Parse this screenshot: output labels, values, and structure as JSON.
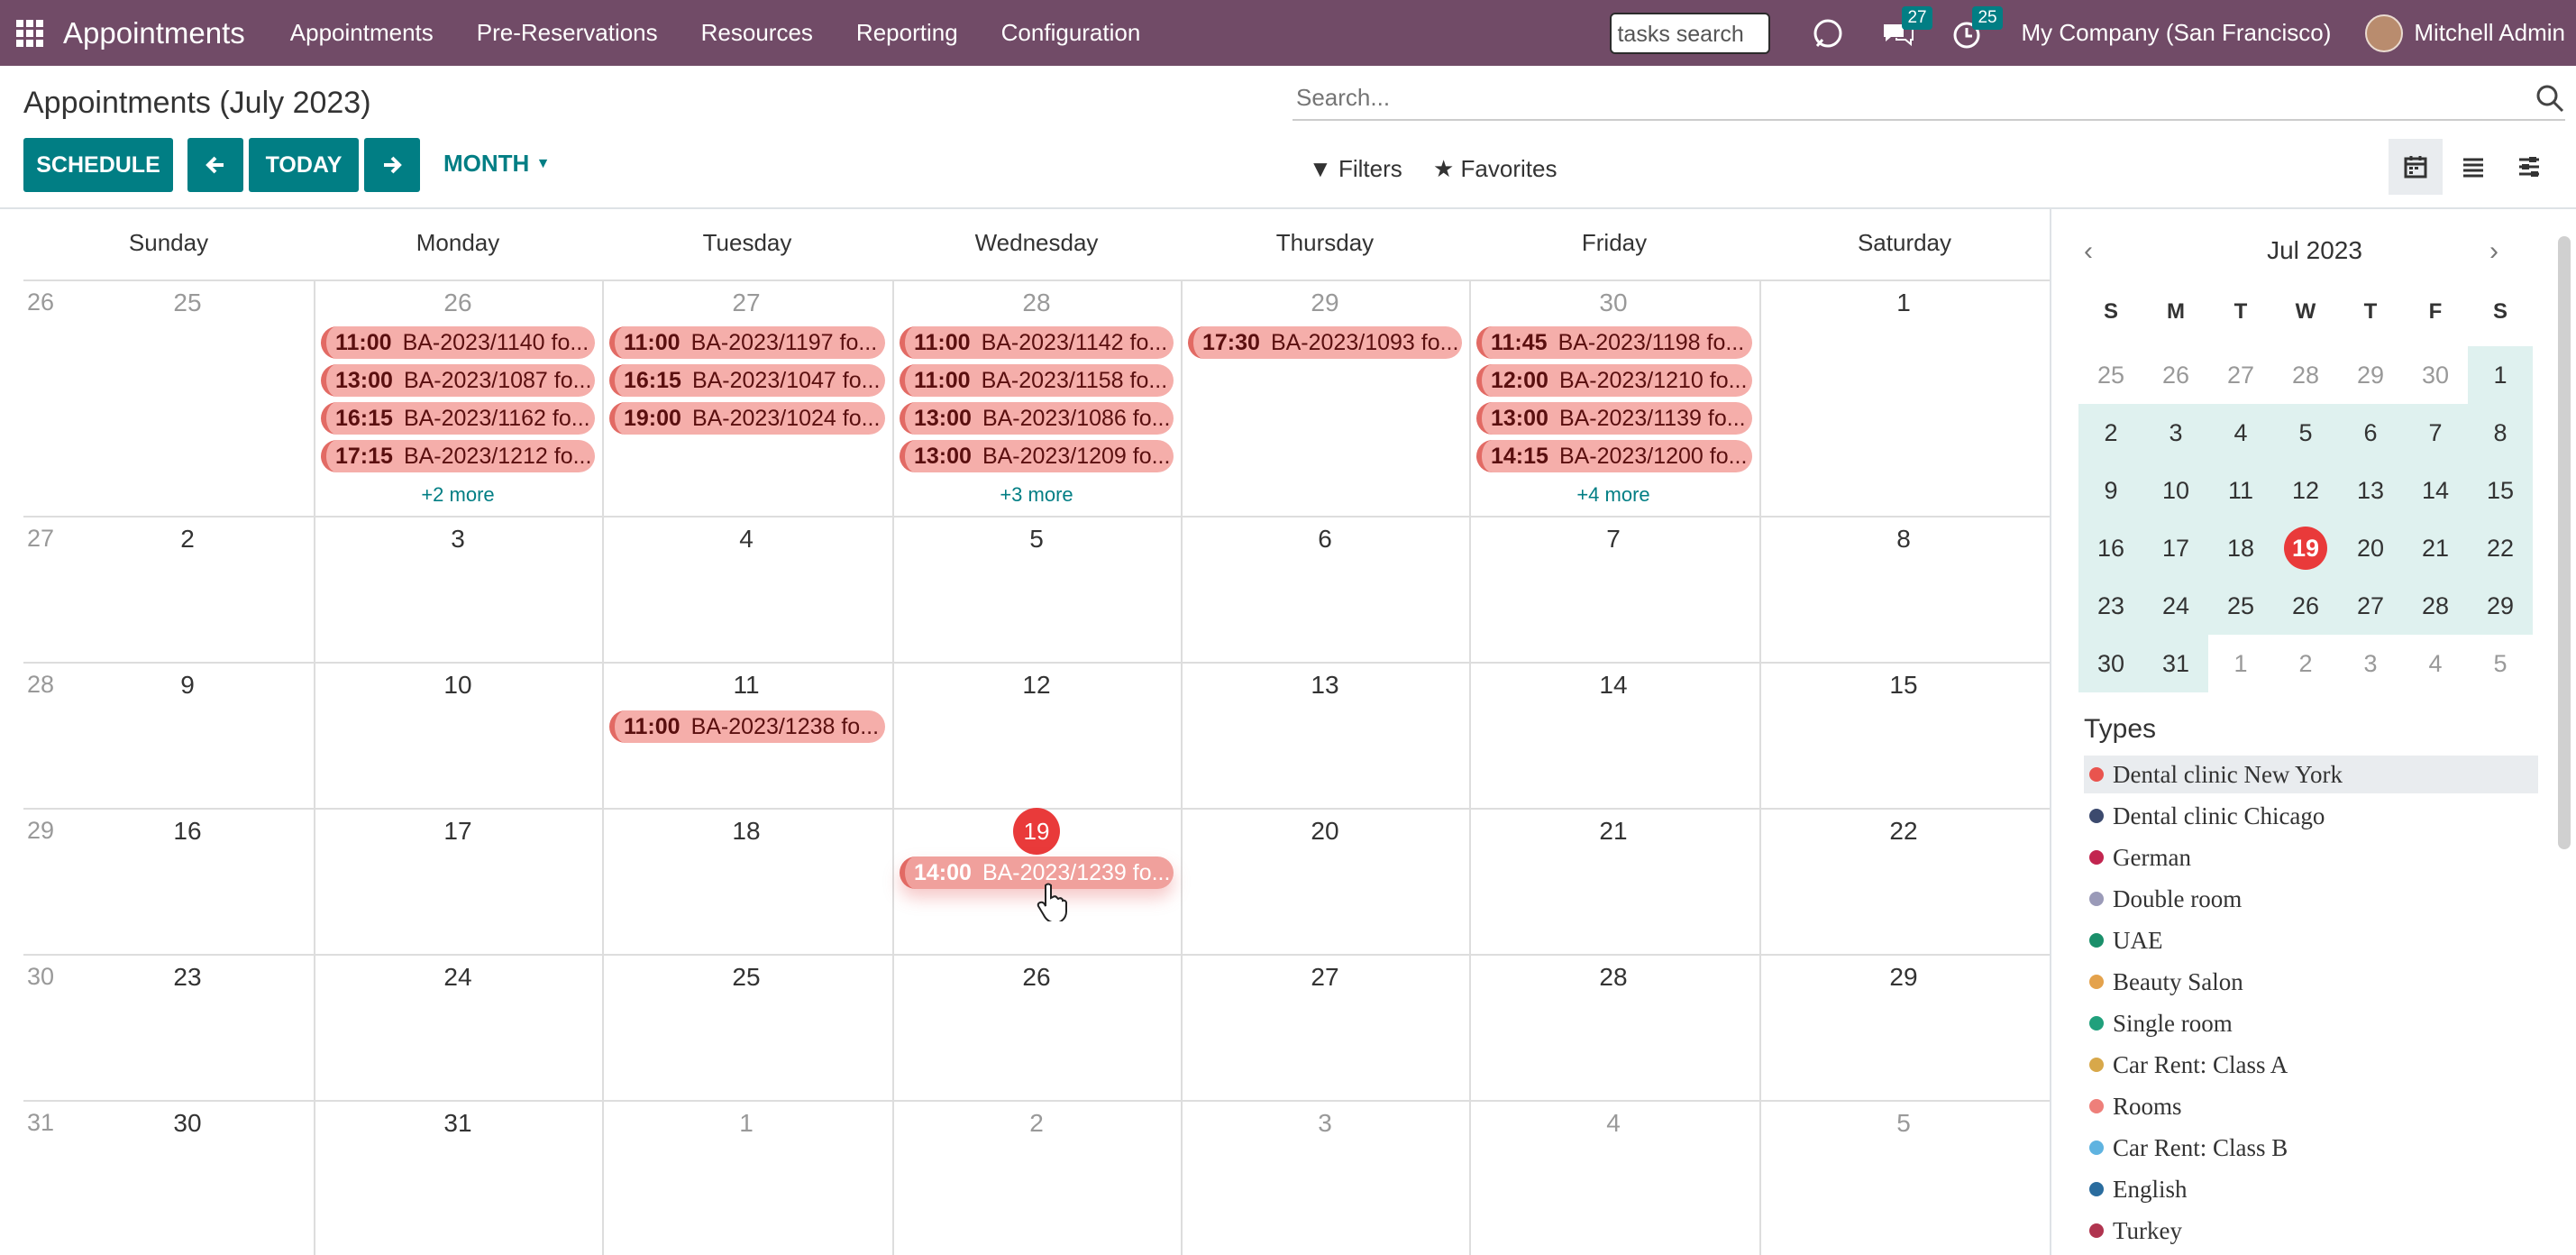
{
  "nav": {
    "brand": "Appointments",
    "menus": [
      "Appointments",
      "Pre-Reservations",
      "Resources",
      "Reporting",
      "Configuration"
    ],
    "tasks_search": "tasks search",
    "messages_count": "27",
    "activities_count": "25",
    "company": "My Company (San Francisco)",
    "user": "Mitchell Admin"
  },
  "control": {
    "title": "Appointments (July 2023)",
    "schedule": "SCHEDULE",
    "today": "TODAY",
    "month": "MONTH",
    "search_placeholder": "Search...",
    "filters": "Filters",
    "favorites": "Favorites"
  },
  "calendar": {
    "days": [
      "Sunday",
      "Monday",
      "Tuesday",
      "Wednesday",
      "Thursday",
      "Friday",
      "Saturday"
    ],
    "week_numbers": [
      "26",
      "27",
      "28",
      "29",
      "30",
      "31"
    ],
    "weeks": [
      [
        "25",
        "26",
        "27",
        "28",
        "29",
        "30",
        "1"
      ],
      [
        "2",
        "3",
        "4",
        "5",
        "6",
        "7",
        "8"
      ],
      [
        "9",
        "10",
        "11",
        "12",
        "13",
        "14",
        "15"
      ],
      [
        "16",
        "17",
        "18",
        "19",
        "20",
        "21",
        "22"
      ],
      [
        "23",
        "24",
        "25",
        "26",
        "27",
        "28",
        "29"
      ],
      [
        "30",
        "31",
        "1",
        "2",
        "3",
        "4",
        "5"
      ]
    ],
    "events": {
      "mon26": [
        {
          "time": "11:00",
          "label": "BA-2023/1140 fo..."
        },
        {
          "time": "13:00",
          "label": "BA-2023/1087 fo..."
        },
        {
          "time": "16:15",
          "label": "BA-2023/1162 fo..."
        },
        {
          "time": "17:15",
          "label": "BA-2023/1212 fo..."
        }
      ],
      "mon26_more": "+2 more",
      "tue27": [
        {
          "time": "11:00",
          "label": "BA-2023/1197 fo..."
        },
        {
          "time": "16:15",
          "label": "BA-2023/1047 fo..."
        },
        {
          "time": "19:00",
          "label": "BA-2023/1024 fo..."
        }
      ],
      "wed28": [
        {
          "time": "11:00",
          "label": "BA-2023/1142 fo..."
        },
        {
          "time": "11:00",
          "label": "BA-2023/1158 fo..."
        },
        {
          "time": "13:00",
          "label": "BA-2023/1086 fo..."
        },
        {
          "time": "13:00",
          "label": "BA-2023/1209 fo..."
        }
      ],
      "wed28_more": "+3 more",
      "thu29": [
        {
          "time": "17:30",
          "label": "BA-2023/1093 fo..."
        }
      ],
      "fri30": [
        {
          "time": "11:45",
          "label": "BA-2023/1198 fo..."
        },
        {
          "time": "12:00",
          "label": "BA-2023/1210 fo..."
        },
        {
          "time": "13:00",
          "label": "BA-2023/1139 fo..."
        },
        {
          "time": "14:15",
          "label": "BA-2023/1200 fo..."
        }
      ],
      "fri30_more": "+4 more",
      "tue11": [
        {
          "time": "11:00",
          "label": "BA-2023/1238 fo..."
        }
      ],
      "wed19": [
        {
          "time": "14:00",
          "label": "BA-2023/1239 fo..."
        }
      ]
    }
  },
  "mini": {
    "month": "Jul 2023",
    "dow": [
      "S",
      "M",
      "T",
      "W",
      "T",
      "F",
      "S"
    ],
    "weeks": [
      [
        "25",
        "26",
        "27",
        "28",
        "29",
        "30",
        "1"
      ],
      [
        "2",
        "3",
        "4",
        "5",
        "6",
        "7",
        "8"
      ],
      [
        "9",
        "10",
        "11",
        "12",
        "13",
        "14",
        "15"
      ],
      [
        "16",
        "17",
        "18",
        "19",
        "20",
        "21",
        "22"
      ],
      [
        "23",
        "24",
        "25",
        "26",
        "27",
        "28",
        "29"
      ],
      [
        "30",
        "31",
        "1",
        "2",
        "3",
        "4",
        "5"
      ]
    ]
  },
  "types": {
    "title": "Types",
    "items": [
      {
        "name": "Dental clinic New York",
        "color": "#e9544e"
      },
      {
        "name": "Dental clinic Chicago",
        "color": "#3c4a6e"
      },
      {
        "name": "German",
        "color": "#c2254f"
      },
      {
        "name": "Double room",
        "color": "#9a9ab8"
      },
      {
        "name": "UAE",
        "color": "#1a8f6a"
      },
      {
        "name": "Beauty Salon",
        "color": "#e4a24c"
      },
      {
        "name": "Single room",
        "color": "#20a07c"
      },
      {
        "name": "Car Rent: Class A",
        "color": "#d8a84a"
      },
      {
        "name": "Rooms",
        "color": "#ee7f7a"
      },
      {
        "name": "Car Rent: Class B",
        "color": "#5fb3e0"
      },
      {
        "name": "English",
        "color": "#2a6c9e"
      },
      {
        "name": "Turkey",
        "color": "#b0344f"
      }
    ]
  },
  "colors": {
    "navbar": "#714b67",
    "primary": "#017e84",
    "today": "#e93a3a",
    "event": "#f5aeaa"
  }
}
